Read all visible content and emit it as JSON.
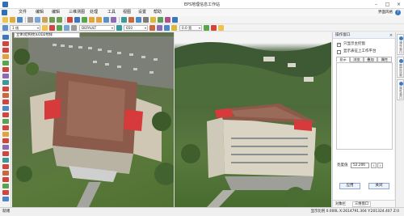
{
  "window": {
    "title": "EPS地理信息工作站"
  },
  "menu": {
    "items": [
      "文件",
      "编辑",
      "编辑",
      "三维测图",
      "处理",
      "工具",
      "视图",
      "设置",
      "帮助"
    ],
    "theme_label": "界面风格",
    "help_icon": "?"
  },
  "toolbar2": {
    "layer_combo": "1 线",
    "style_combo": "DEFAULT",
    "scale_combo": "650",
    "width_combo": "0.0 宽"
  },
  "viewport": {
    "tab_label": "立体(结构纹)LOD2纹样"
  },
  "panel": {
    "title": "操作窗口",
    "close": "×",
    "checkbox1": "只显示主控窗",
    "checkbox2": "显示表征上工作平台",
    "tabs": [
      "显示",
      "浏览",
      "叠加",
      "属性"
    ],
    "gen_label": "亮度值",
    "gen_value": "52.206",
    "apply_button": "应用",
    "close_button": "关闭",
    "bottom_tabs": [
      "对象栏",
      "三维窗口"
    ]
  },
  "dock": {
    "tabs": [
      "操作窗口",
      "图层控制",
      "属性窗口"
    ]
  },
  "status": {
    "left": "就绪",
    "coords": "显示比例 0.000L  X:2614791.304 Y:201324.407 Z:0"
  },
  "colors": {
    "accent": "#2f6fb6",
    "roof": "#8b5a4a",
    "red_roof": "#d63a3a",
    "grass": "#4f7a34",
    "facade": "#d8d2c2"
  }
}
